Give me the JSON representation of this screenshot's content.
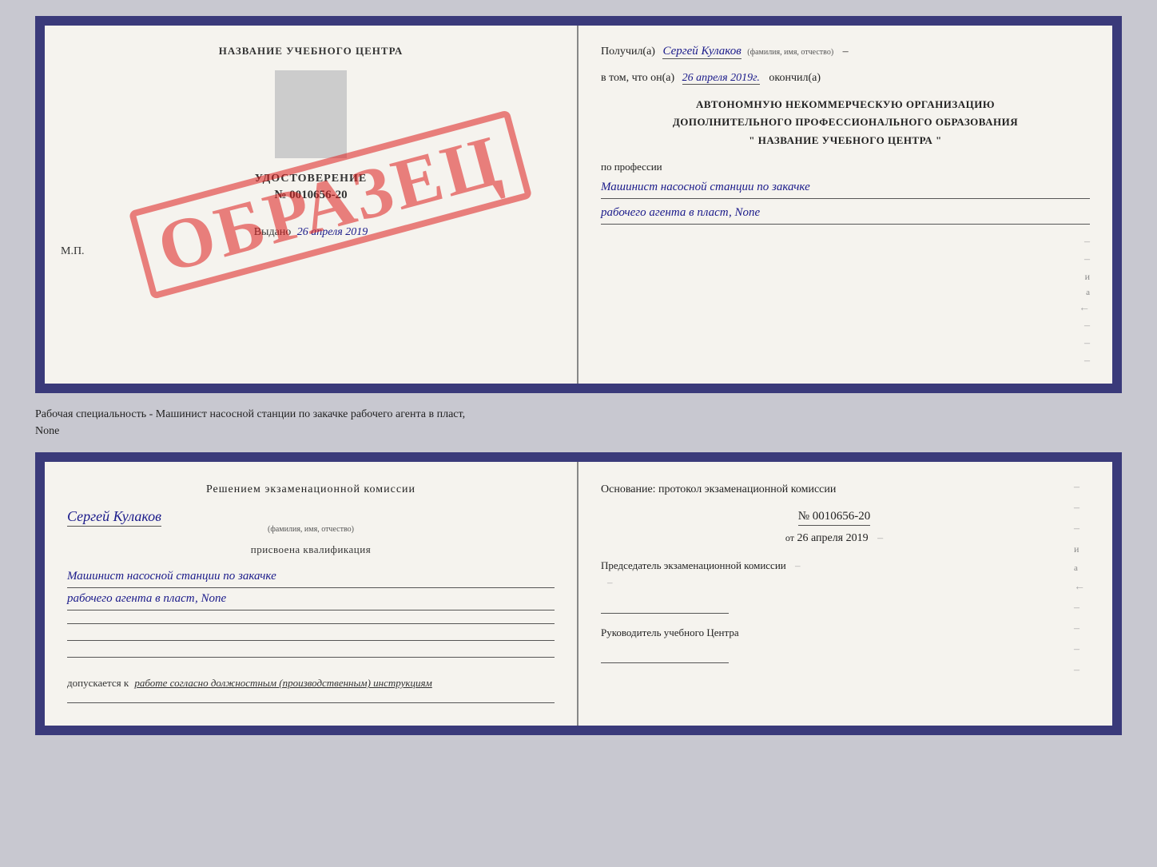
{
  "cert_top": {
    "school_name": "НАЗВАНИЕ УЧЕБНОГО ЦЕНТРА",
    "udostoverenie_label": "УДОСТОВЕРЕНИЕ",
    "cert_number": "№ 0010656-20",
    "vydano_label": "Выдано",
    "vydano_date": "26 апреля 2019",
    "mp_label": "М.П.",
    "obrazec": "ОБРАЗЕЦ",
    "poluchil_prefix": "Получил(а)",
    "recipient_name": "Сергей Кулаков",
    "fio_subtitle": "(фамилия, имя, отчество)",
    "vtom_prefix": "в том, что он(а)",
    "vtom_date": "26 апреля 2019г.",
    "okonchil": "окончил(а)",
    "org_line1": "АВТОНОМНУЮ НЕКОММЕРЧЕСКУЮ ОРГАНИЗАЦИЮ",
    "org_line2": "ДОПОЛНИТЕЛЬНОГО ПРОФЕССИОНАЛЬНОГО ОБРАЗОВАНИЯ",
    "org_line3": "\"  НАЗВАНИЕ УЧЕБНОГО ЦЕНТРА  \"",
    "po_professii": "по профессии",
    "profession_line1": "Машинист насосной станции по закачке",
    "profession_line2": "рабочего агента в пласт, None"
  },
  "middle": {
    "text": "Рабочая специальность - Машинист насосной станции по закачке рабочего агента в пласт,",
    "text2": "None"
  },
  "cert_bottom": {
    "left": {
      "resolution_title": "Решением экзаменационной комиссии",
      "person_name": "Сергей Кулаков",
      "fio_subtitle": "(фамилия, имя, отчество)",
      "prisvoena": "присвоена квалификация",
      "qualification_line1": "Машинист насосной станции по закачке",
      "qualification_line2": "рабочего агента в пласт, None",
      "dopuskaetsya_prefix": "допускается к",
      "dopuskaetsya_text": "работе согласно должностным (производственным) инструкциям"
    },
    "right": {
      "osnovanie_label": "Основание: протокол экзаменационной комиссии",
      "proto_number": "№ 0010656-20",
      "ot_prefix": "от",
      "ot_date": "26 апреля 2019",
      "chairman_label": "Председатель экзаменационной комиссии",
      "rukovoditel_label": "Руководитель учебного Центра"
    }
  }
}
